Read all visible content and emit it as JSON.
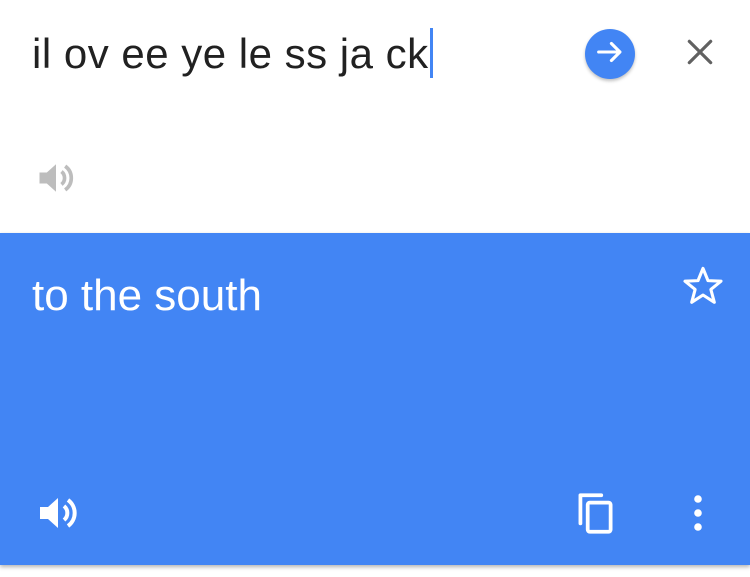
{
  "input": {
    "text": "il ov ee ye le ss ja ck",
    "go_icon": "arrow-right-icon",
    "clear_icon": "close-icon",
    "speaker_icon": "speaker-icon"
  },
  "result": {
    "text": "to the south",
    "star_icon": "star-outline-icon",
    "speaker_icon": "speaker-icon",
    "copy_icon": "copy-icon",
    "more_icon": "more-vert-icon"
  },
  "colors": {
    "accent": "#4285f4",
    "input_text": "#212121",
    "muted_icon": "#bdbdbd",
    "dark_icon": "#616161",
    "white": "#ffffff"
  }
}
